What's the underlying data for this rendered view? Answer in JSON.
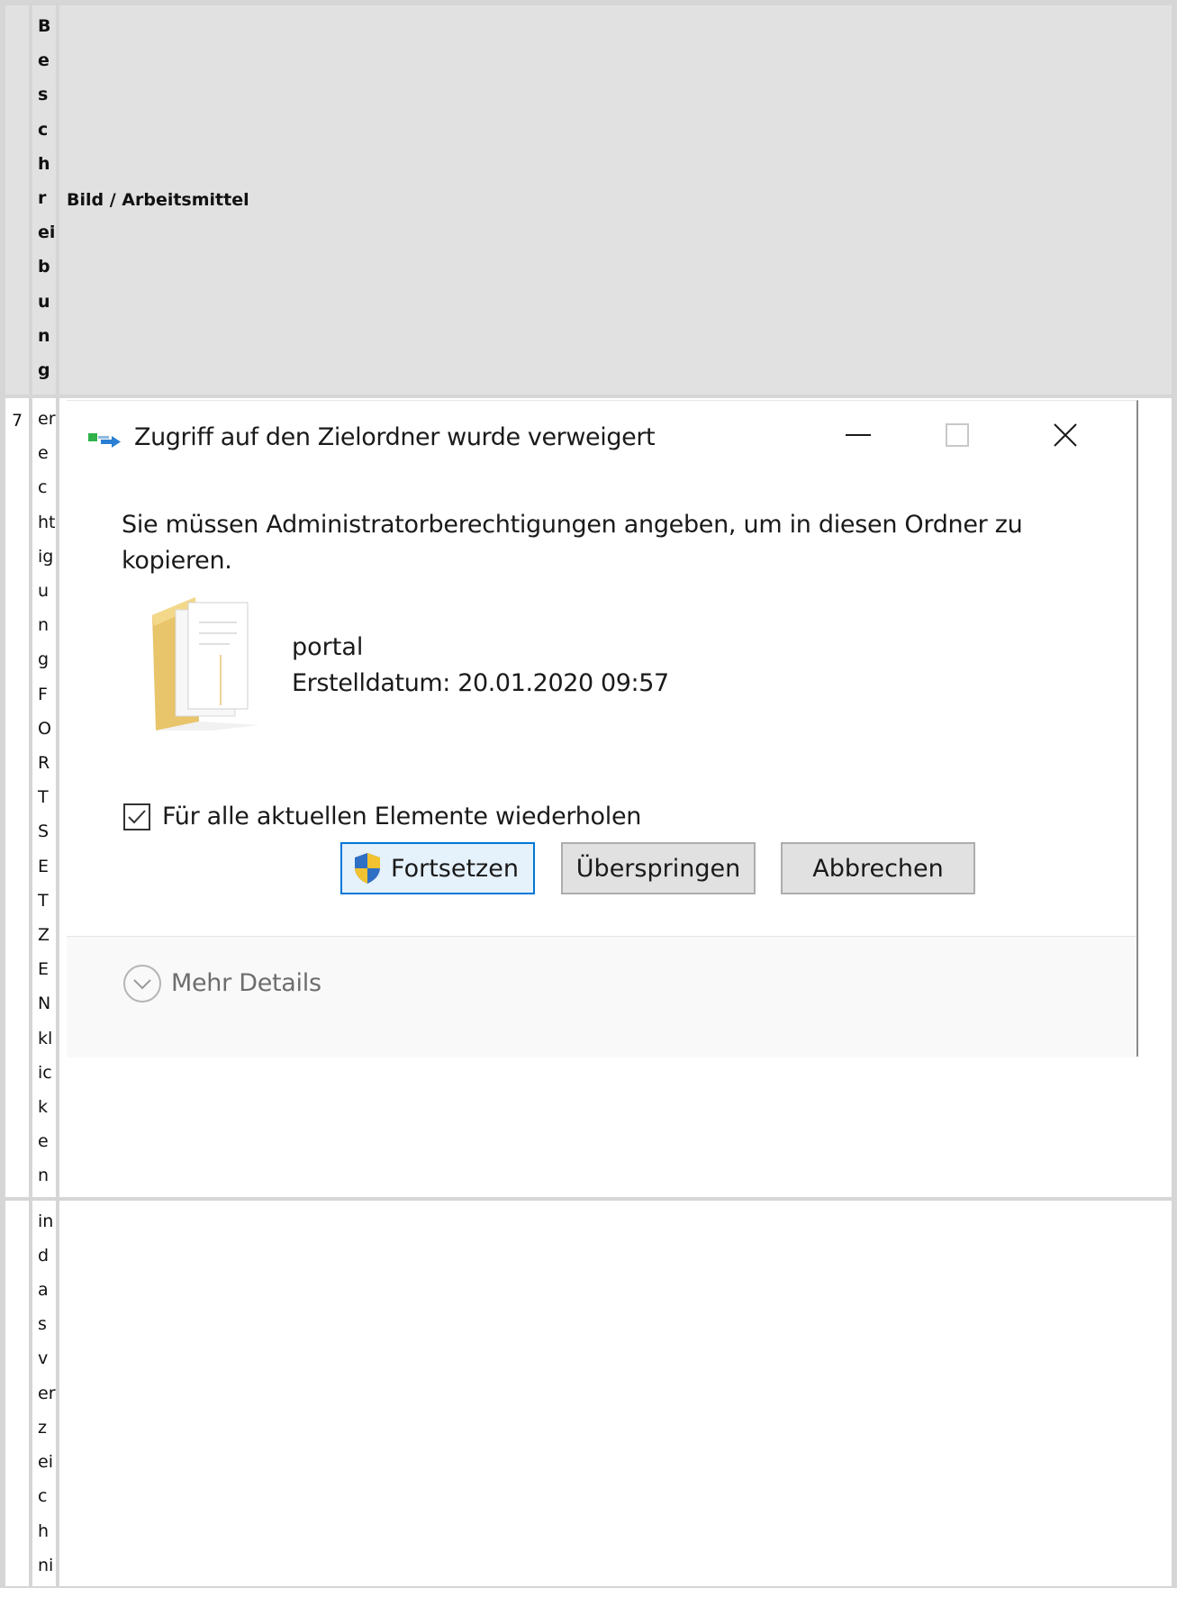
{
  "table": {
    "header": {
      "number": "",
      "description_vertical": "B\ne\ns\nc\nh\nr\nei\nb\nu\nn\ng",
      "image_column": "Bild / Arbeitsmittel"
    },
    "rows": [
      {
        "number": "7",
        "description_vertical": "er\ne\nc\nht\nig\nu\nn\ng\nF\nO\nR\nT\nS\nE\nT\nZ\nE\nN\nkl\nic\nk\ne\nn"
      },
      {
        "number": "",
        "description_vertical": "in\nd\na\ns\nv\ner\nz\nei\nc\nh\nni"
      }
    ]
  },
  "dialog": {
    "title": "Zugriff auf den Zielordner wurde verweigert",
    "message": "Sie müssen Administratorberechtigungen angeben, um in diesen Ordner zu kopieren.",
    "file_name": "portal",
    "file_date": "Erstelldatum: 20.01.2020 09:57",
    "checkbox_label": "Für alle aktuellen Elemente wiederholen",
    "checkbox_checked": true,
    "buttons": {
      "continue": "Fortsetzen",
      "skip": "Überspringen",
      "cancel": "Abbrechen"
    },
    "details_label": "Mehr Details",
    "window_controls": {
      "minimize_icon": "minimize-icon",
      "maximize_icon": "maximize-icon",
      "close_icon": "close-icon"
    },
    "colors": {
      "primary_button_border": "#0078d7",
      "primary_button_bg": "#e5f1fb",
      "button_bg": "#e1e1e1",
      "details_text": "#6d6d6d"
    }
  }
}
